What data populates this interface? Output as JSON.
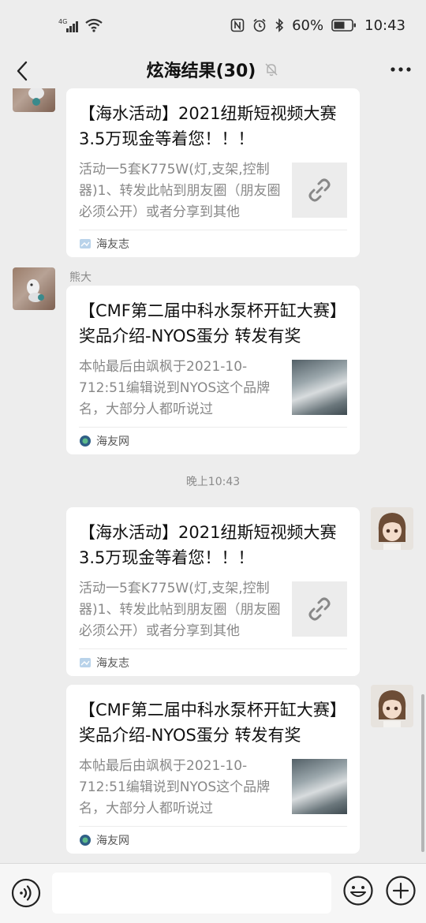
{
  "status_bar": {
    "network": "4G",
    "battery": "60%",
    "time": "10:43"
  },
  "header": {
    "title": "炫海结果(30)",
    "mute_icon": "bell-off-icon",
    "more_icon": "more-dots-icon",
    "back_icon": "chevron-left-icon"
  },
  "messages": [
    {
      "sender": "",
      "title": "【海水活动】2021纽斯短视频大赛 3.5万现金等着您！！！",
      "description": "活动一5套K775W(灯,支架,控制器)1、转发此帖到朋友圈（朋友圈必须公开）或者分享到其他",
      "thumb_icon": "link-icon",
      "source": "海友志"
    },
    {
      "sender": "熊大",
      "title": "【CMF第二届中科水泵杯开缸大赛】奖品介绍-NYOS蛋分 转发有奖",
      "description": "本帖最后由飒枫于2021-10-712:51编辑说到NYOS这个品牌名，大部分人都听说过",
      "thumb_icon": "photo-thumbnail",
      "source": "海友网"
    },
    {
      "title": "【海水活动】2021纽斯短视频大赛 3.5万现金等着您！！！",
      "description": "活动一5套K775W(灯,支架,控制器)1、转发此帖到朋友圈（朋友圈必须公开）或者分享到其他",
      "thumb_icon": "link-icon",
      "source": "海友志"
    },
    {
      "title": "【CMF第二届中科水泵杯开缸大赛】奖品介绍-NYOS蛋分 转发有奖",
      "description": "本帖最后由飒枫于2021-10-712:51编辑说到NYOS这个品牌名，大部分人都听说过",
      "thumb_icon": "photo-thumbnail",
      "source": "海友网"
    }
  ],
  "time_separator": "晚上10:43",
  "input_bar": {
    "voice_icon": "voice-icon",
    "emoji_icon": "emoji-icon",
    "plus_icon": "plus-circle-icon",
    "placeholder": ""
  },
  "colors": {
    "background": "#ededed",
    "card": "#ffffff",
    "muted_text": "#888888"
  }
}
